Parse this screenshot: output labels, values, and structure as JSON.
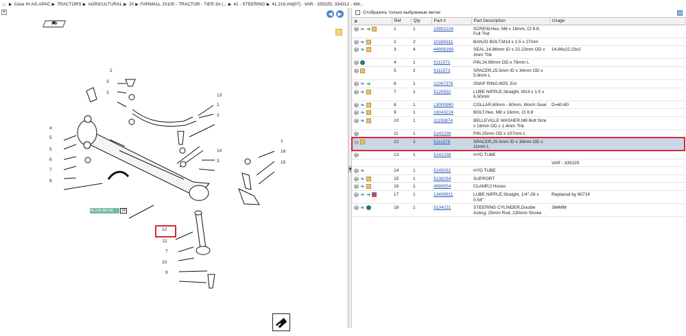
{
  "breadcrumbs": [
    "Case IH AG APAC",
    "TRACTORS",
    "AGRICULTURAL",
    "JX",
    "FARMALL JX100 - TRACTOR - TIER 3A (...",
    "41 - STEERING",
    "41.216.AN[07] - VAR - 335325, 334312 - 4W..."
  ],
  "panel_labels": {
    "show_selected_marks": "Отобразить только выбранные метки",
    "column_ref": "Ref",
    "column_qty": "Qty",
    "column_part": "Part #",
    "column_description": "Part Description",
    "column_usage": "Usage"
  },
  "diagram": {
    "callouts": [
      "2",
      "3",
      "3",
      "13",
      "1",
      "2",
      "3",
      "4",
      "5",
      "5",
      "6",
      "7",
      "8",
      "14",
      "3",
      "1",
      "16",
      "15",
      "12",
      "11",
      "7",
      "10",
      "9"
    ],
    "reference_box": "41.216.AN 08",
    "reference_number": "18"
  },
  "parts": [
    {
      "ref": "1",
      "qty": "1",
      "part": "10902224",
      "desc": "SCREW,Hex, M6 x 16mm, Cl 8.8, Full Thd",
      "usage": "",
      "icons": [
        "plus",
        "blue",
        "green",
        "box"
      ]
    },
    {
      "ref": "2",
      "qty": "2",
      "part": "10184311",
      "desc": "BANJO BOLT,M14 x 1.5 x 27mm",
      "usage": "",
      "icons": [
        "plus",
        "blue",
        "box"
      ]
    },
    {
      "ref": "3",
      "qty": "4",
      "part": "44906168",
      "desc": "SEAL,14.86mm ID x 22.23mm OD x 3mm Thk",
      "usage": "14.86x22.23x2",
      "icons": [
        "plus",
        "blue",
        "box"
      ]
    },
    {
      "ref": "4",
      "qty": "1",
      "part": "5111572",
      "desc": "PIN,24.99mm OD x 76mm L",
      "usage": "",
      "icons": [
        "plus",
        "teal"
      ]
    },
    {
      "ref": "5",
      "qty": "2",
      "part": "5111573",
      "desc": "SPACER,25.5mm ID x 34mm OD x 5.9mm L",
      "usage": "",
      "icons": [
        "plus",
        "box"
      ]
    },
    {
      "ref": "6",
      "qty": "1",
      "part": "11067376",
      "desc": "SNAP RING,M25, Ext",
      "usage": "",
      "icons": [
        "plus",
        "blue",
        "green"
      ]
    },
    {
      "ref": "7",
      "qty": "1",
      "part": "5120532",
      "desc": "LUBE NIPPLE,Straight, M14 x 1.5 x 6.50mm",
      "usage": "",
      "icons": [
        "plus",
        "blue",
        "box"
      ]
    },
    {
      "ref": "8",
      "qty": "1",
      "part": "13000990",
      "desc": "COLLAR,60mm - 80mm, Worm Gear",
      "usage": "D=60-80",
      "icons": [
        "plus",
        "blue",
        "box"
      ]
    },
    {
      "ref": "9",
      "qty": "1",
      "part": "16043224",
      "desc": "BOLT,Hex, M8 x 16mm, Cl 8.8",
      "usage": "",
      "icons": [
        "plus",
        "blue",
        "box"
      ]
    },
    {
      "ref": "10",
      "qty": "1",
      "part": "11193874",
      "desc": "BELLEVILLE WASHER,M8 Bolt Size x 16mm OD x 1.4mm Thk",
      "usage": "",
      "icons": [
        "plus",
        "blue",
        "box"
      ]
    },
    {
      "ref": "11",
      "qty": "1",
      "part": "5142236",
      "desc": "PIN,25mm OD x 107mm L",
      "usage": "",
      "icons": [
        "plus"
      ]
    },
    {
      "ref": "12",
      "qty": "1",
      "part": "5111576",
      "desc": "SPACER,25.5mm ID x 34mm OD x 11mm L",
      "usage": "",
      "icons": [
        "plus",
        "box"
      ],
      "selected": true
    },
    {
      "ref": "13",
      "qty": "1",
      "part": "5142238",
      "desc": "HYD TUBE",
      "usage": "",
      "icons": [
        "plus"
      ]
    },
    {
      "ref": "",
      "qty": "",
      "part": "",
      "desc": "",
      "usage": "VAR - 335325",
      "icons": []
    },
    {
      "ref": "14",
      "qty": "1",
      "part": "5145031",
      "desc": "HYD TUBE",
      "usage": "",
      "icons": [
        "plus",
        "blue"
      ]
    },
    {
      "ref": "15",
      "qty": "1",
      "part": "5138294",
      "desc": "SUPPORT",
      "usage": "",
      "icons": [
        "plus",
        "blue",
        "box"
      ]
    },
    {
      "ref": "16",
      "qty": "1",
      "part": "4999554",
      "desc": "CLAMP,2 Hoses",
      "usage": "",
      "icons": [
        "plus",
        "blue",
        "box"
      ]
    },
    {
      "ref": "17",
      "qty": "1",
      "part": "13406911",
      "desc": "LUBE NIPPLE,Straight, 1/4\"-28 x 0.54\"",
      "usage": "Replaced by 80714",
      "icons": [
        "plus",
        "blue",
        "green",
        "flag"
      ]
    },
    {
      "ref": "18",
      "qty": "1",
      "part": "5134221",
      "desc": "STEERING CYLINDER,Double Acting, 25mm Rod, 230mm Stroke",
      "usage": "384MM",
      "icons": [
        "plus",
        "blue",
        "teal"
      ]
    }
  ]
}
